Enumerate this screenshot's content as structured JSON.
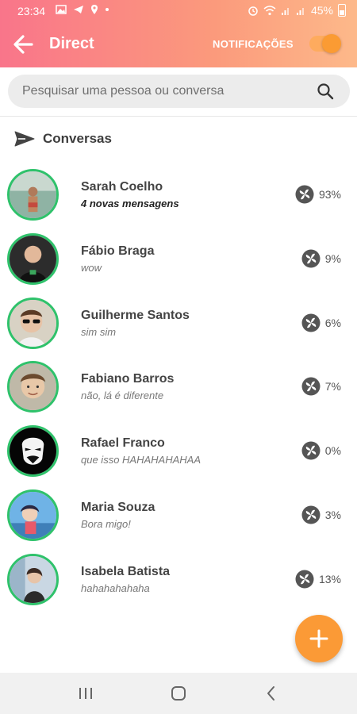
{
  "status": {
    "time": "23:34",
    "battery": "45%",
    "icons": [
      "image-icon",
      "telegram-icon",
      "location-icon",
      "dot-icon",
      "alarm-icon",
      "wifi-icon",
      "signal-icon",
      "signal-icon",
      "battery-icon"
    ]
  },
  "appbar": {
    "title": "Direct",
    "notifications_label": "NOTIFICAÇÕES",
    "notifications_on": true
  },
  "search": {
    "placeholder": "Pesquisar uma pessoa ou conversa"
  },
  "section": {
    "title": "Conversas"
  },
  "conversations": [
    {
      "name": "Sarah Coelho",
      "message": "4 novas mensagens",
      "unread": true,
      "percent": "93%"
    },
    {
      "name": "Fábio Braga",
      "message": "wow",
      "unread": false,
      "percent": "9%"
    },
    {
      "name": "Guilherme Santos",
      "message": "sim sim",
      "unread": false,
      "percent": "6%"
    },
    {
      "name": "Fabiano Barros",
      "message": "não, lá é diferente",
      "unread": false,
      "percent": "7%"
    },
    {
      "name": "Rafael Franco",
      "message": "que isso HAHAHAHAHAA",
      "unread": false,
      "percent": "0%"
    },
    {
      "name": "Maria Souza",
      "message": "Bora migo!",
      "unread": false,
      "percent": "3%"
    },
    {
      "name": "Isabela Batista",
      "message": "hahahahahaha",
      "unread": false,
      "percent": "13%"
    }
  ],
  "colors": {
    "header_start": "#f9758a",
    "header_end": "#fdb98a",
    "accent": "#fb9a36",
    "avatar_ring": "#2fc26b"
  }
}
